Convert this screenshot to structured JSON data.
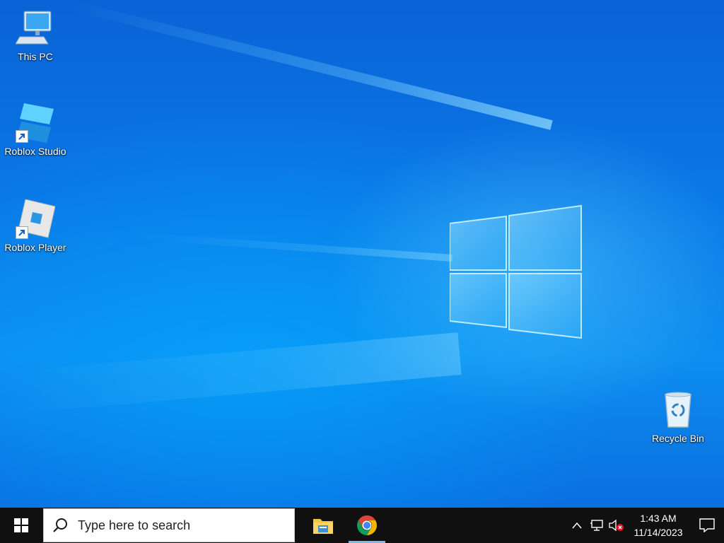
{
  "desktop": {
    "icons": [
      {
        "label": "This PC",
        "icon": "this-pc-icon"
      },
      {
        "label": "Roblox Studio",
        "icon": "roblox-studio-icon"
      },
      {
        "label": "Roblox Player",
        "icon": "roblox-player-icon"
      },
      {
        "label": "Recycle Bin",
        "icon": "recycle-bin-icon"
      }
    ]
  },
  "taskbar": {
    "start_icon": "windows-logo-icon",
    "search": {
      "placeholder": "Type here to search",
      "icon": "search-icon"
    },
    "apps": [
      {
        "name": "File Explorer",
        "icon": "file-explorer-icon",
        "active": false
      },
      {
        "name": "Google Chrome",
        "icon": "chrome-icon",
        "active": true
      }
    ],
    "tray": {
      "time": "1:43 AM",
      "date": "11/14/2023"
    }
  },
  "colors": {
    "taskbar_bg": "#101010",
    "accent": "#76b9ed",
    "desktop_blue": "#0a78e6"
  }
}
